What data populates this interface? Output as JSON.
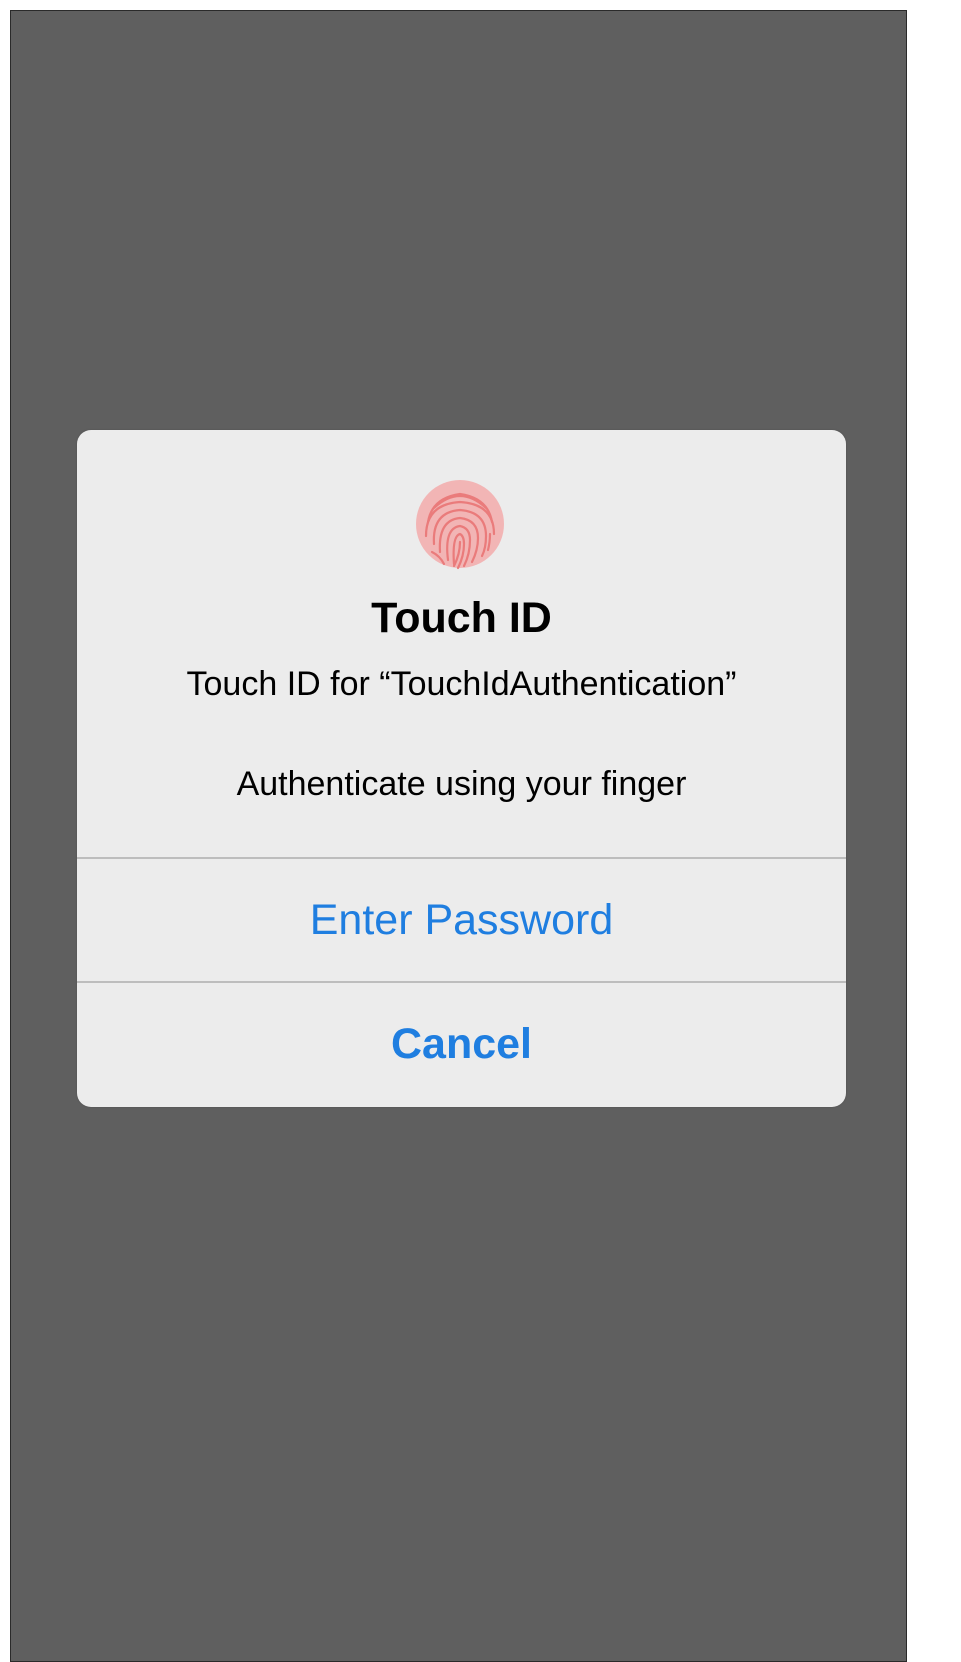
{
  "alert": {
    "title": "Touch ID",
    "subtitle": "Touch ID for “TouchIdAuthentication”",
    "message": "Authenticate using your finger",
    "buttons": {
      "enter_password": "Enter Password",
      "cancel": "Cancel"
    },
    "icon": "fingerprint-icon"
  },
  "colors": {
    "background": "#5f5f5f",
    "alert_background": "#ececec",
    "button_text": "#1f7ee0",
    "fingerprint": "#ea7b7b",
    "divider": "#bdbdbd"
  }
}
